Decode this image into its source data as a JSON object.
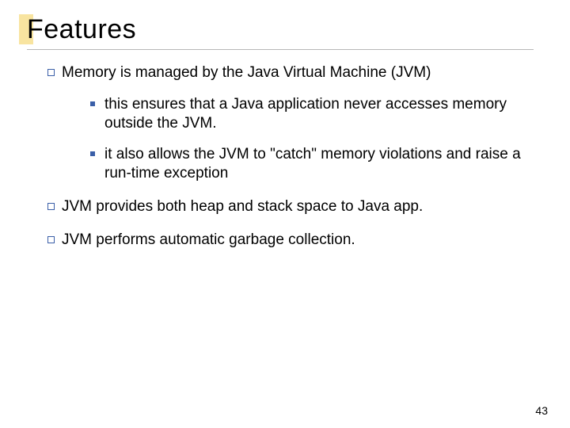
{
  "slide": {
    "title": "Features",
    "bullets": [
      {
        "text": "Memory is managed by the Java Virtual Machine (JVM)",
        "children": [
          {
            "text": "this ensures that a Java application never accesses memory outside the JVM."
          },
          {
            "text": "it also allows the JVM to \"catch\" memory violations and raise a run-time exception"
          }
        ]
      },
      {
        "text": "JVM provides both heap and stack space to Java app."
      },
      {
        "text": "JVM performs automatic garbage collection."
      }
    ],
    "page_number": "43"
  },
  "colors": {
    "accent_block": "#f8e4a0",
    "bullet": "#3a5fa8"
  }
}
